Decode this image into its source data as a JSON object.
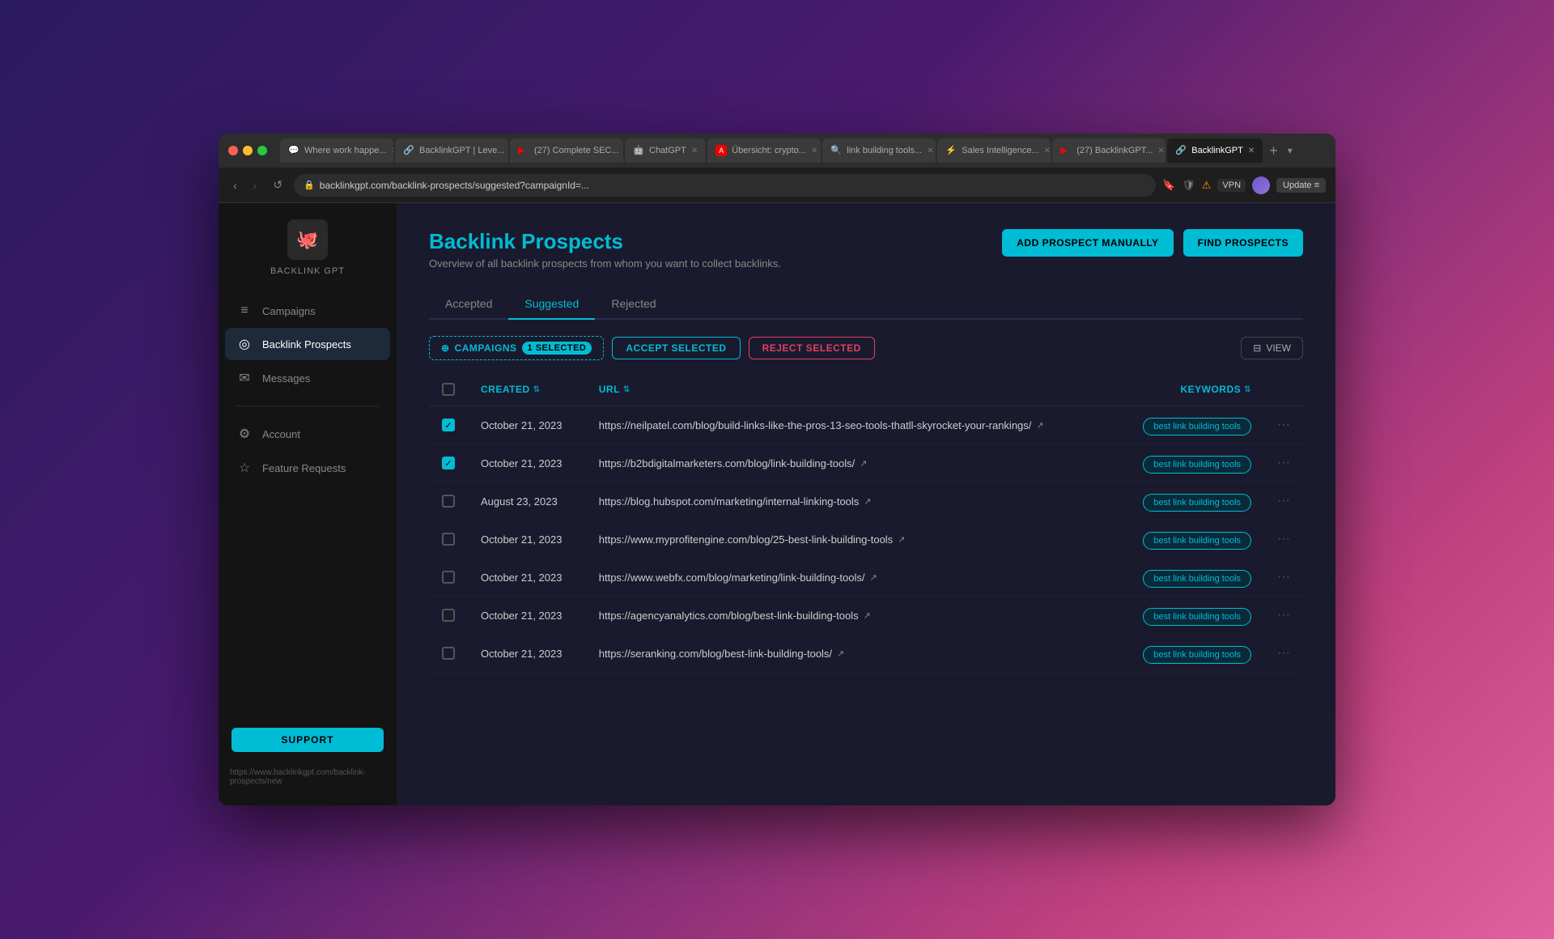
{
  "browser": {
    "tabs": [
      {
        "id": "t1",
        "favicon": "💬",
        "label": "Where work happe...",
        "active": false
      },
      {
        "id": "t2",
        "favicon": "🔗",
        "label": "BacklinkGPT | Leve...",
        "active": false
      },
      {
        "id": "t3",
        "favicon": "▶",
        "label": "(27) Complete SEC...",
        "active": false
      },
      {
        "id": "t4",
        "favicon": "💬",
        "label": "ChatGPT",
        "active": false
      },
      {
        "id": "t5",
        "favicon": "A",
        "label": "Übersicht: crypto...",
        "active": false
      },
      {
        "id": "t6",
        "favicon": "🔍",
        "label": "link building tools...",
        "active": false
      },
      {
        "id": "t7",
        "favicon": "⚡",
        "label": "Sales Intelligence ...",
        "active": false
      },
      {
        "id": "t8",
        "favicon": "▶",
        "label": "(27) BacklinkGPT ...",
        "active": false
      },
      {
        "id": "t9",
        "favicon": "🔗",
        "label": "BacklinkGPT",
        "active": true
      }
    ],
    "url": "backlinkgpt.com/backlink-prospects/suggested?campaignId=...",
    "statusbar": "https://www.backlinkgpt.com/backlink-prospects/new"
  },
  "sidebar": {
    "logo_icon": "🐙",
    "logo_text": "BACKLINK GPT",
    "nav_items": [
      {
        "id": "campaigns",
        "icon": "≡",
        "label": "Campaigns",
        "active": false
      },
      {
        "id": "backlink-prospects",
        "icon": "○",
        "label": "Backlink Prospects",
        "active": true
      },
      {
        "id": "messages",
        "icon": "✉",
        "label": "Messages",
        "active": false
      }
    ],
    "nav_bottom": [
      {
        "id": "account",
        "icon": "⚙",
        "label": "Account",
        "active": false
      },
      {
        "id": "feature-requests",
        "icon": "☆",
        "label": "Feature Requests",
        "active": false
      }
    ],
    "support_label": "SUPPORT"
  },
  "page": {
    "title": "Backlink Prospects",
    "subtitle": "Overview of all backlink prospects from whom you want to collect backlinks.",
    "actions": {
      "add_prospect": "ADD PROSPECT MANUALLY",
      "find_prospects": "FIND PROSPECTS"
    },
    "tabs": [
      {
        "id": "accepted",
        "label": "Accepted",
        "active": false
      },
      {
        "id": "suggested",
        "label": "Suggested",
        "active": true
      },
      {
        "id": "rejected",
        "label": "Rejected",
        "active": false
      }
    ],
    "toolbar": {
      "campaigns_label": "CAMPAIGNS",
      "selected_badge": "1 SELECTED",
      "accept_label": "ACCEPT SELECTED",
      "reject_label": "REJECT SELECTED",
      "view_label": "VIEW"
    },
    "table": {
      "columns": [
        {
          "id": "created",
          "label": "CREATED"
        },
        {
          "id": "url",
          "label": "URL"
        },
        {
          "id": "keywords",
          "label": "KEYWORDS"
        }
      ],
      "rows": [
        {
          "id": "row1",
          "checked": true,
          "date": "October 21, 2023",
          "url": "https://neilpatel.com/blog/build-links-like-the-pros-13-seo-tools-thatll-skyrocket-your-rankings/",
          "keyword": "best link building tools"
        },
        {
          "id": "row2",
          "checked": true,
          "date": "October 21, 2023",
          "url": "https://b2bdigitalmarketers.com/blog/link-building-tools/",
          "keyword": "best link building tools"
        },
        {
          "id": "row3",
          "checked": false,
          "date": "August 23, 2023",
          "url": "https://blog.hubspot.com/marketing/internal-linking-tools",
          "keyword": "best link building tools"
        },
        {
          "id": "row4",
          "checked": false,
          "date": "October 21, 2023",
          "url": "https://www.myprofitengine.com/blog/25-best-link-building-tools",
          "keyword": "best link building tools"
        },
        {
          "id": "row5",
          "checked": false,
          "date": "October 21, 2023",
          "url": "https://www.webfx.com/blog/marketing/link-building-tools/",
          "keyword": "best link building tools"
        },
        {
          "id": "row6",
          "checked": false,
          "date": "October 21, 2023",
          "url": "https://agencyanalytics.com/blog/best-link-building-tools",
          "keyword": "best link building tools"
        },
        {
          "id": "row7",
          "checked": false,
          "date": "October 21, 2023",
          "url": "https://seranking.com/blog/best-link-building-tools/",
          "keyword": "best link building tools"
        }
      ]
    }
  }
}
